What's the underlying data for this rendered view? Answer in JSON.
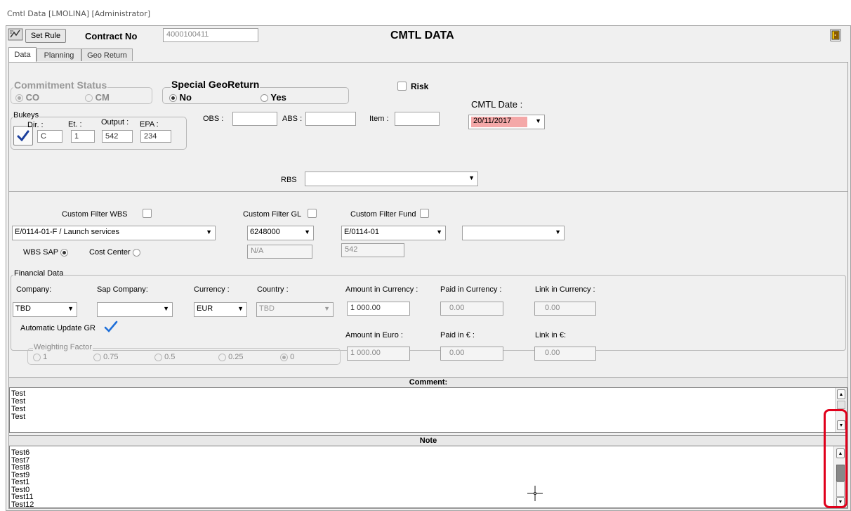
{
  "window": {
    "title": "Cmtl Data [LMOLINA] [Administrator]"
  },
  "toolbar": {
    "set_rule_label": "Set Rule",
    "contract_no_label": "Contract No",
    "contract_no_value": "4000100411",
    "main_title": "CMTL DATA"
  },
  "tabs": [
    {
      "label": "Data",
      "active": true
    },
    {
      "label": "Planning",
      "active": false
    },
    {
      "label": "Geo Return",
      "active": false
    }
  ],
  "commitment_status": {
    "legend": "Commitment Status",
    "options": [
      "CO",
      "CM"
    ],
    "selected": "CO"
  },
  "special_georeturn": {
    "legend": "Special GeoReturn",
    "options": [
      "No",
      "Yes"
    ],
    "selected": "No"
  },
  "risk": {
    "label": "Risk",
    "checked": false
  },
  "cmtl_date": {
    "label": "CMTL Date :",
    "value": "20/11/2017",
    "highlight": "#f4a8a8"
  },
  "bukeys": {
    "legend": "Bukeys",
    "dir_label": "Dir. :",
    "dir_value": "C",
    "et_label": "Et. :",
    "et_value": "1",
    "output_label": "Output :",
    "output_value": "542",
    "epa_label": "EPA :",
    "epa_value": "234"
  },
  "obs": {
    "label": "OBS :",
    "value": ""
  },
  "abs": {
    "label": "ABS :",
    "value": ""
  },
  "item": {
    "label": "Item :",
    "value": ""
  },
  "rbs": {
    "label": "RBS",
    "value": ""
  },
  "filters": {
    "wbs_label": "Custom Filter WBS",
    "gl_label": "Custom Filter GL",
    "fund_label": "Custom Filter Fund",
    "wbs_value": "E/0114-01-F / Launch services",
    "gl_value": "6248000",
    "fund_value": "E/0114-01",
    "extra_value": "",
    "gl_sub_value": "N/A",
    "fund_sub_value": "542",
    "wbs_sap_label": "WBS SAP",
    "cost_center_label": "Cost Center"
  },
  "financial": {
    "legend": "Financial Data",
    "company_label": "Company:",
    "company_value": "TBD",
    "sap_company_label": "Sap Company:",
    "sap_company_value": "",
    "currency_label": "Currency :",
    "currency_value": "EUR",
    "country_label": "Country :",
    "country_value": "TBD",
    "amount_currency_label": "Amount in Currency :",
    "amount_currency_value": "1 000.00",
    "paid_currency_label": "Paid in Currency :",
    "paid_currency_value": "0.00",
    "link_currency_label": "Link in Currency :",
    "link_currency_value": "0.00",
    "amount_euro_label": "Amount in Euro :",
    "amount_euro_value": "1 000.00",
    "paid_euro_label": "Paid in € :",
    "paid_euro_value": "0.00",
    "link_euro_label": "Link in €:",
    "link_euro_value": "0.00",
    "auto_update_label": "Automatic Update GR",
    "weighting_legend": "Weighting Factor",
    "weighting_options": [
      "1",
      "0.75",
      "0.5",
      "0.25",
      "0"
    ],
    "weighting_selected": "0"
  },
  "comment": {
    "header": "Comment:",
    "lines": [
      "Test",
      "Test",
      "Test",
      "Test"
    ]
  },
  "note": {
    "header": "Note",
    "lines": [
      "Test6",
      "Test7",
      "Test8",
      "Test9",
      "Test1",
      "Test0",
      "Test11",
      "Test12"
    ]
  },
  "colors": {
    "accent_check": "#1e6fd9",
    "annotation_red": "#e0001b",
    "date_highlight": "#f4a8a8"
  }
}
